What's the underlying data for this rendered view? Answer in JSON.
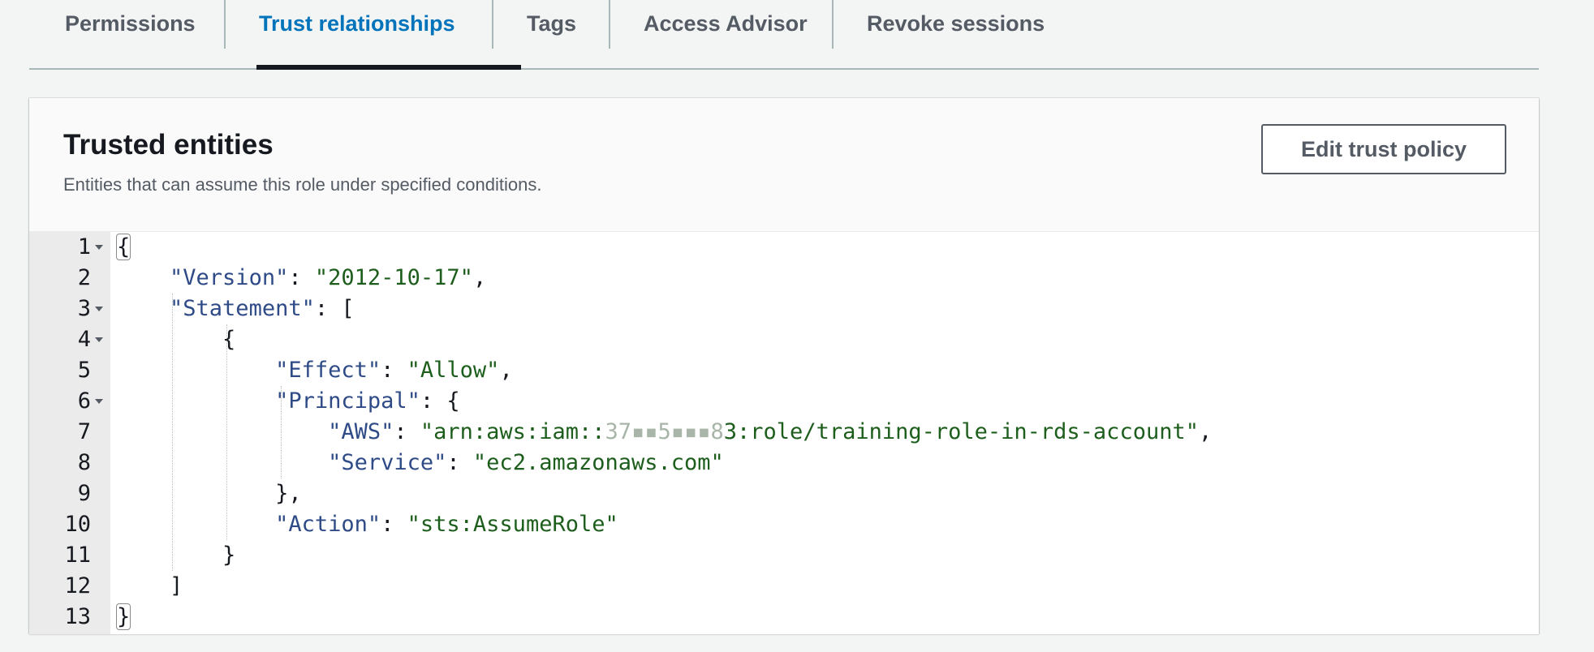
{
  "tabs": [
    {
      "label": "Permissions",
      "active": false
    },
    {
      "label": "Trust relationships",
      "active": true
    },
    {
      "label": "Tags",
      "active": false
    },
    {
      "label": "Access Advisor",
      "active": false
    },
    {
      "label": "Revoke sessions",
      "active": false
    }
  ],
  "panel": {
    "title": "Trusted entities",
    "description": "Entities that can assume this role under specified conditions.",
    "edit_button": "Edit trust policy"
  },
  "policy": {
    "lines": [
      {
        "num": "1",
        "foldable": true
      },
      {
        "num": "2",
        "foldable": false
      },
      {
        "num": "3",
        "foldable": true
      },
      {
        "num": "4",
        "foldable": true
      },
      {
        "num": "5",
        "foldable": false
      },
      {
        "num": "6",
        "foldable": true
      },
      {
        "num": "7",
        "foldable": false
      },
      {
        "num": "8",
        "foldable": false
      },
      {
        "num": "9",
        "foldable": false
      },
      {
        "num": "10",
        "foldable": false
      },
      {
        "num": "11",
        "foldable": false
      },
      {
        "num": "12",
        "foldable": false
      },
      {
        "num": "13",
        "foldable": false
      }
    ],
    "version_key": "\"Version\"",
    "version_value": "\"2012-10-17\"",
    "statement_key": "\"Statement\"",
    "effect_key": "\"Effect\"",
    "effect_value": "\"Allow\"",
    "principal_key": "\"Principal\"",
    "aws_key": "\"AWS\"",
    "aws_value_prefix": "\"arn:aws:iam::",
    "aws_value_redacted": "37▪▪5▪▪▪8",
    "aws_value_suffix": "3:role/training-role-in-rds-account\"",
    "service_key": "\"Service\"",
    "service_value": "\"ec2.amazonaws.com\"",
    "action_key": "\"Action\"",
    "action_value": "\"sts:AssumeRole\""
  },
  "colors": {
    "active_tab": "#0073bb",
    "json_key": "#2e4a87",
    "json_string": "#1d5e1d"
  }
}
